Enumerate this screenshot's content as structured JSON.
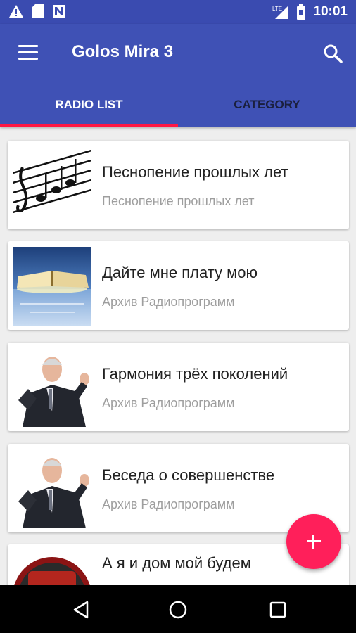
{
  "status_bar": {
    "time": "10:01",
    "network": "LTE",
    "icons": [
      "warning-icon",
      "sd-card-icon",
      "n-notification-icon",
      "signal-icon",
      "battery-icon"
    ]
  },
  "app_bar": {
    "title": "Golos Mira 3",
    "menu_icon": "hamburger-menu-icon",
    "search_icon": "search-icon",
    "background": "#3f51b5",
    "status_background": "#3a4bb0"
  },
  "tabs": [
    {
      "label": "RADIO LIST",
      "selected": true
    },
    {
      "label": "CATEGORY",
      "selected": false
    }
  ],
  "tab_indicator_color": "#ff1744",
  "items": [
    {
      "title": "Песнопение прошлых лет",
      "subtitle": "Песнопение прошлых лет",
      "thumbnail": "music-notes"
    },
    {
      "title": "Дайте мне плату мою",
      "subtitle": "Архив Радиопрограмм",
      "thumbnail": "open-bible"
    },
    {
      "title": "Гармония трёх поколений",
      "subtitle": "Архив Радиопрограмм",
      "thumbnail": "speaker-man"
    },
    {
      "title": "Беседа о совершенстве",
      "subtitle": "Архив Радиопрограмм",
      "thumbnail": "speaker-man"
    },
    {
      "title": "А я и дом мой будем",
      "subtitle": "",
      "thumbnail": "red-disc"
    }
  ],
  "fab": {
    "icon": "plus-icon",
    "color": "#ff1f5a"
  },
  "nav_bar": {
    "buttons": [
      "back-icon",
      "home-icon",
      "recents-icon"
    ]
  }
}
